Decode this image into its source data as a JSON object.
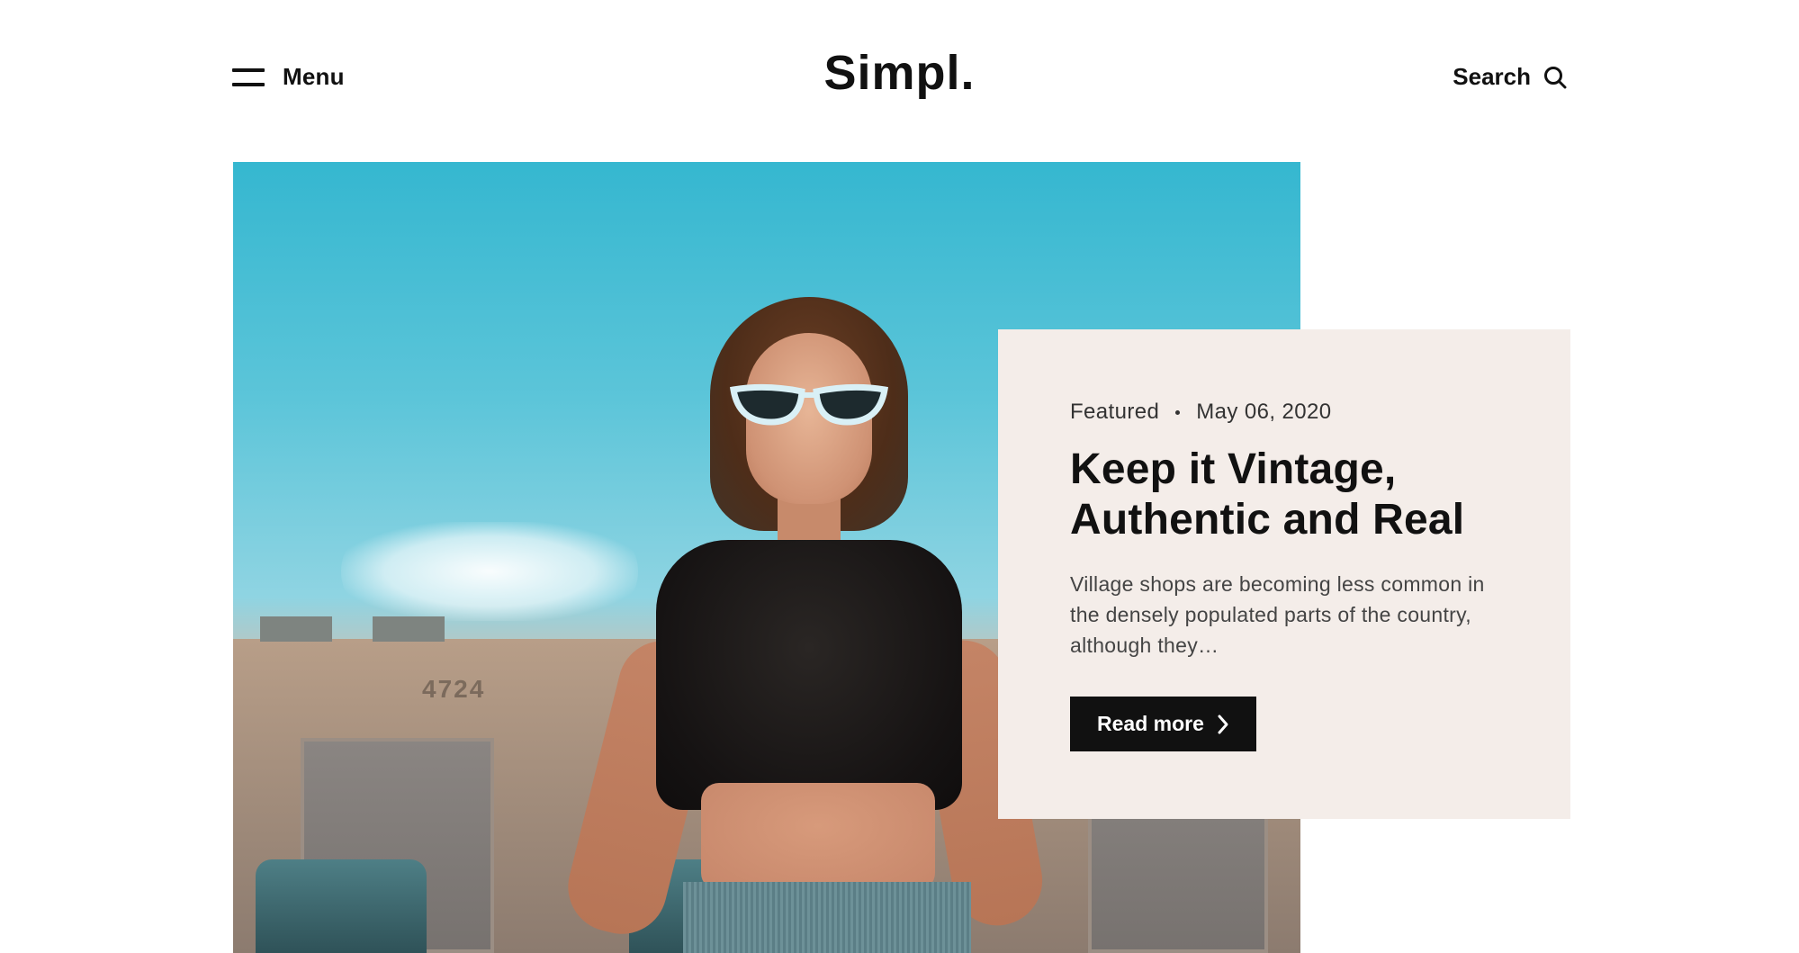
{
  "header": {
    "menu_label": "Menu",
    "logo": "Simpl.",
    "search_label": "Search"
  },
  "featured": {
    "category": "Featured",
    "date": "May 06, 2020",
    "title": "Keep it Vintage, Authentic and Real",
    "excerpt": "Village shops are becoming less common in the densely populated parts of the country, although they…",
    "read_more_label": "Read more"
  },
  "hero_photo": {
    "building_sign": "4724"
  },
  "colors": {
    "card_background": "#f4ede9",
    "button_background": "#111111",
    "text": "#111111"
  },
  "icons": {
    "menu": "hamburger-icon",
    "search": "search-icon",
    "read_more": "chevron-right-icon"
  }
}
